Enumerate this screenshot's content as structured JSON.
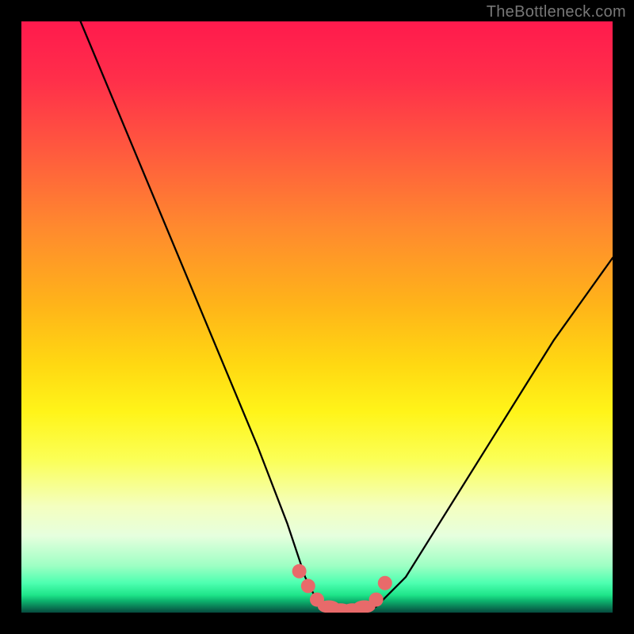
{
  "watermark": "TheBottleneck.com",
  "chart_data": {
    "type": "line",
    "title": "",
    "xlabel": "",
    "ylabel": "",
    "xlim": [
      0,
      100
    ],
    "ylim": [
      0,
      100
    ],
    "series": [
      {
        "name": "bottleneck-curve",
        "x": [
          10,
          15,
          20,
          25,
          30,
          35,
          40,
          45,
          48,
          50,
          52,
          54,
          56,
          58,
          60,
          65,
          70,
          75,
          80,
          85,
          90,
          95,
          100
        ],
        "y": [
          100,
          88,
          76,
          64,
          52,
          40,
          28,
          15,
          6,
          2,
          0.5,
          0,
          0,
          0,
          1,
          6,
          14,
          22,
          30,
          38,
          46,
          53,
          60
        ]
      }
    ],
    "markers": {
      "name": "highlighted-points",
      "color": "#e86a6a",
      "x": [
        47,
        48.5,
        50,
        52,
        54,
        56,
        58,
        60,
        61.5
      ],
      "y": [
        7,
        4.5,
        2.2,
        1,
        0.5,
        0.5,
        1,
        2.2,
        5
      ]
    }
  }
}
